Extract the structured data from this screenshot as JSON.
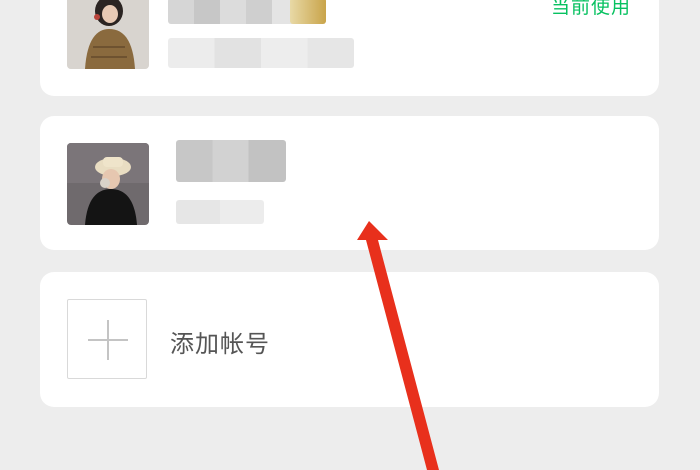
{
  "accounts": [
    {
      "status_label": "当前使用",
      "avatar": "avatar-photo-girl-sweater"
    },
    {
      "status_label": "",
      "avatar": "avatar-photo-girl-hat"
    }
  ],
  "add_account": {
    "label": "添加帐号",
    "icon": "plus-icon"
  },
  "colors": {
    "accent": "#07c160",
    "background": "#ededed",
    "card": "#ffffff",
    "arrow": "#e8301c"
  }
}
